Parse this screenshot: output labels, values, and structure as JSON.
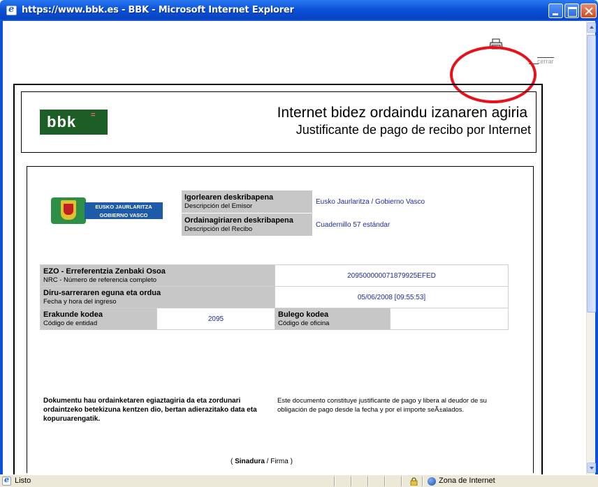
{
  "window": {
    "title": "https://www.bbk.es - BBK - Microsoft Internet Explorer"
  },
  "toolbar": {
    "print_icon": "printer-icon",
    "close_label": "cerrar"
  },
  "document": {
    "logo_text": "bbk",
    "logo_sup": "=",
    "title_eu": "Internet bidez ordaindu izanaren agiria",
    "title_es": "Justificante de pago de recibo por Internet",
    "emblem": {
      "line1": "EUSKO JAURLARITZA",
      "line2": "GOBIERNO VASCO"
    },
    "issuer": {
      "label_eu": "Igorlearen deskribapena",
      "label_es": "Descripción del Emisor",
      "value": "Eusko Jaurlaritza / Gobierno Vasco"
    },
    "receipt": {
      "label_eu": "Ordainagiriaren deskribapena",
      "label_es": "Descripción del Recibo",
      "value": "Cuadernillo 57 estándar"
    },
    "nrc": {
      "label_eu": "EZO - Erreferentzia Zenbaki Osoa",
      "label_es": "NRC - Número de referencia completo",
      "value": "209500000071879925EFED"
    },
    "date": {
      "label_eu": "Diru-sarreraren eguna eta ordua",
      "label_es": "Fecha y hora del ingreso",
      "value": "05/06/2008 [09:55:53]"
    },
    "entity": {
      "label_eu": "Erakunde kodea",
      "label_es": "Código de entidad",
      "value": "2095"
    },
    "office": {
      "label_eu": "Bulego kodea",
      "label_es": "Código de oficina",
      "value": ""
    },
    "footer_eu": "Dokumentu hau ordainketaren egiaztagiria da eta zordunari ordaintzeko betekizuna kentzen dio, bertan adierazitako data eta kopuruarengatik.",
    "footer_es": "Este documento constituye justificante de pago y libera al deudor de su obligación de pago desde la fecha y por el importe seÃ±alados.",
    "signature_open": "( ",
    "signature_eu": "Sinadura",
    "signature_sep": " / Firma )"
  },
  "statusbar": {
    "status": "Listo",
    "zone": "Zona de Internet"
  },
  "colors": {
    "titlebar": "#0a52d8",
    "annotation": "#e8101a",
    "bbk_green": "#1d5e26",
    "value_text": "#1e2a9e",
    "label_bg": "#c7c7c7"
  }
}
